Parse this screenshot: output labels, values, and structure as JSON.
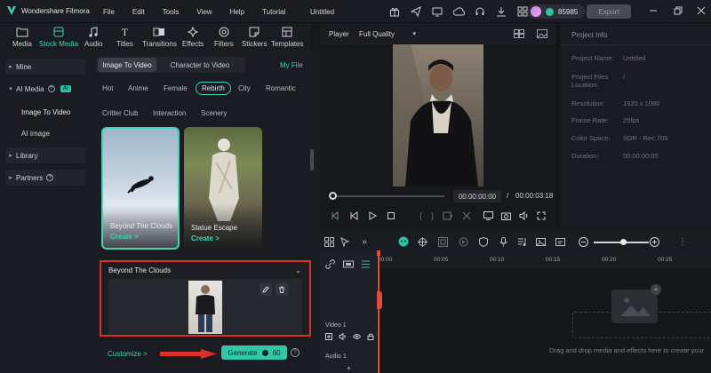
{
  "app": {
    "name": "Wondershare Filmora",
    "project_title": "Untitled"
  },
  "menu": [
    "File",
    "Edit",
    "Tools",
    "View",
    "Help",
    "Tutorial"
  ],
  "title_bar": {
    "credits": "85985",
    "export_label": "Export"
  },
  "media_toolbar": [
    {
      "label": "Media",
      "icon": "folder-icon"
    },
    {
      "label": "Stock Media",
      "icon": "cloud-box-icon",
      "active": true
    },
    {
      "label": "Audio",
      "icon": "music-icon"
    },
    {
      "label": "Titles",
      "icon": "text-icon"
    },
    {
      "label": "Transitions",
      "icon": "transition-icon"
    },
    {
      "label": "Effects",
      "icon": "effects-icon"
    },
    {
      "label": "Filters",
      "icon": "filters-icon"
    },
    {
      "label": "Stickers",
      "icon": "sticker-icon"
    },
    {
      "label": "Templates",
      "icon": "templates-icon"
    }
  ],
  "sidebar": {
    "mine": "Mine",
    "ai_media": "AI Media",
    "ai_badge": "AI",
    "image_to_video": "Image To Video",
    "ai_image": "AI Image",
    "library": "Library",
    "partners": "Partners"
  },
  "content": {
    "tabs": [
      "Image To Video",
      "Character to Video"
    ],
    "my_file": "My File",
    "chips_row1": [
      "Hot",
      "Anime",
      "Female",
      "Rebirth",
      "City",
      "Romantic"
    ],
    "active_chip": "Rebirth",
    "chips_row2": [
      "Critter Club",
      "Interaction",
      "Scenery"
    ],
    "cards": [
      {
        "title": "Beyond The Clouds",
        "create": "Create >"
      },
      {
        "title": "Statue Escape",
        "create": "Create >"
      }
    ],
    "details_title": "Beyond The Clouds",
    "customize": "Customize >",
    "generate_label": "Generate",
    "generate_cost": "60"
  },
  "player": {
    "label": "Player",
    "quality": "Full Quality",
    "time_current": "00:00:00:00",
    "time_separator": "/",
    "time_total": "00:00:03:18"
  },
  "project_info": {
    "header": "Project Info",
    "rows": [
      {
        "label": "Project Name:",
        "value": "Untitled"
      },
      {
        "label": "Project Files Location:",
        "value": "/"
      },
      {
        "label": "Resolution:",
        "value": "1920 x 1080"
      },
      {
        "label": "Frame Rate:",
        "value": "25fps"
      },
      {
        "label": "Color Space:",
        "value": "SDR - Rec.709"
      },
      {
        "label": "Duration:",
        "value": "00:00:00:00"
      }
    ]
  },
  "timeline": {
    "ruler": [
      "00:00",
      "00:05",
      "00:10",
      "00:15",
      "00:20",
      "00:25"
    ],
    "video_track": "Video 1",
    "audio_track": "Audio 1",
    "drop_hint": "Drag and drop media and effects here to create your"
  },
  "colors": {
    "accent": "#41d4b8",
    "highlight_red": "#d8322b",
    "generate_bg": "#34c6a9"
  }
}
